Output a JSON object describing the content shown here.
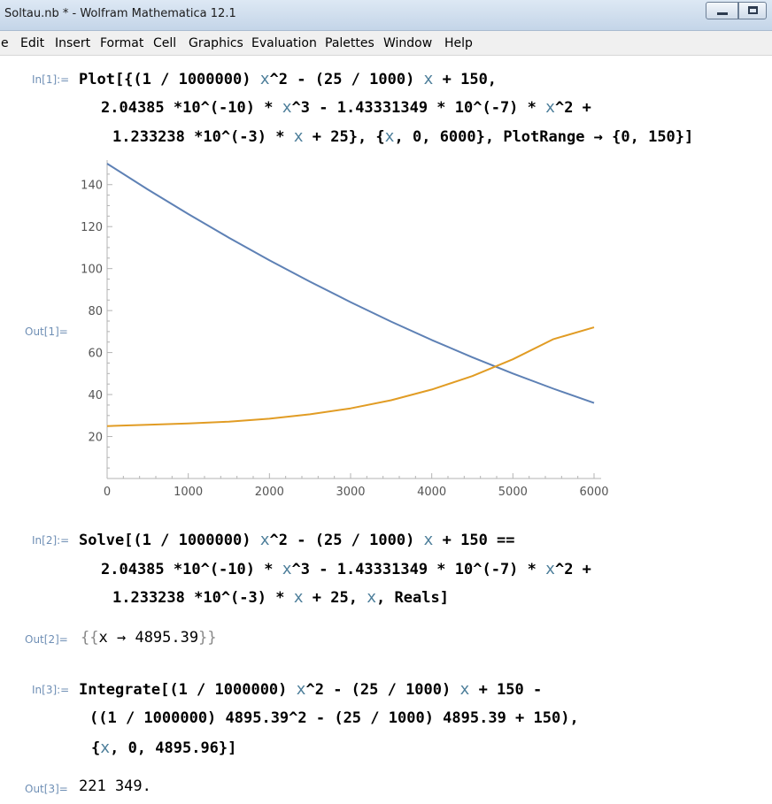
{
  "window": {
    "title": "Soltau.nb * - Wolfram Mathematica 12.1"
  },
  "menu": [
    "e",
    "Edit",
    "Insert",
    "Format",
    "Cell",
    "Graphics",
    "Evaluation",
    "Palettes",
    "Window",
    "Help"
  ],
  "cells": {
    "in1": {
      "label": "In[1]:=",
      "line1": [
        "Plot[{(1 / 1000000) ",
        "x",
        "^2 - (25 / 1000) ",
        "x",
        " + 150,"
      ],
      "line2": [
        "2.04385 *10^(-10) * ",
        "x",
        "^3 - 1.43331349 * 10^(-7) * ",
        "x",
        "^2 +"
      ],
      "line3": [
        "1.233238 *10^(-3) * ",
        "x",
        " + 25}, {",
        "x",
        ", 0, 6000}, PlotRange → {0, 150}]"
      ]
    },
    "out1": {
      "label": "Out[1]="
    },
    "in2": {
      "label": "In[2]:=",
      "line1": [
        "Solve[(1 / 1000000) ",
        "x",
        "^2 - (25 / 1000) ",
        "x",
        " + 150 =="
      ],
      "line2": [
        "2.04385 *10^(-10) * ",
        "x",
        "^3 - 1.43331349 * 10^(-7) * ",
        "x",
        "^2 +"
      ],
      "line3": [
        "1.233238 *10^(-3) * ",
        "x",
        " + 25, ",
        "x",
        ", Reals]"
      ]
    },
    "out2": {
      "label": "Out[2]=",
      "open": "{{",
      "var": "x",
      "arrow": " → ",
      "value": "4895.39",
      "close": "}}"
    },
    "in3": {
      "label": "In[3]:=",
      "line1": [
        "Integrate[(1 / 1000000) ",
        "x",
        "^2 - (25 / 1000) ",
        "x",
        " + 150 -"
      ],
      "line2": [
        "((1 / 1000000) 4895.39^2 - (25 / 1000) 4895.39 + 150),"
      ],
      "line3": [
        "{",
        "x",
        ", 0, 4895.96}]"
      ]
    },
    "out3": {
      "label": "Out[3]=",
      "value": "221 349."
    }
  },
  "chart_data": {
    "type": "line",
    "title": "",
    "xlabel": "",
    "ylabel": "",
    "xlim": [
      0,
      6000
    ],
    "ylim": [
      0,
      150
    ],
    "x_ticks": [
      0,
      1000,
      2000,
      3000,
      4000,
      5000,
      6000
    ],
    "y_ticks": [
      20,
      40,
      60,
      80,
      100,
      120,
      140
    ],
    "grid": false,
    "legend": "none",
    "series": [
      {
        "color": "#5e81b5",
        "x": [
          0,
          500,
          1000,
          1500,
          2000,
          2500,
          3000,
          3500,
          4000,
          4500,
          5000,
          5500,
          6000
        ],
        "y": [
          150,
          137.75,
          126,
          114.75,
          104,
          93.75,
          84,
          74.75,
          66,
          57.75,
          50,
          42.75,
          36
        ]
      },
      {
        "color": "#e19c24",
        "x": [
          0,
          500,
          1000,
          1500,
          2000,
          2500,
          3000,
          3500,
          4000,
          4500,
          5000,
          5500,
          6000
        ],
        "y": [
          25,
          25.6,
          26.2,
          27.1,
          28.5,
          30.6,
          33.4,
          37.3,
          42.4,
          48.8,
          56.8,
          66.4,
          72
        ]
      }
    ]
  }
}
